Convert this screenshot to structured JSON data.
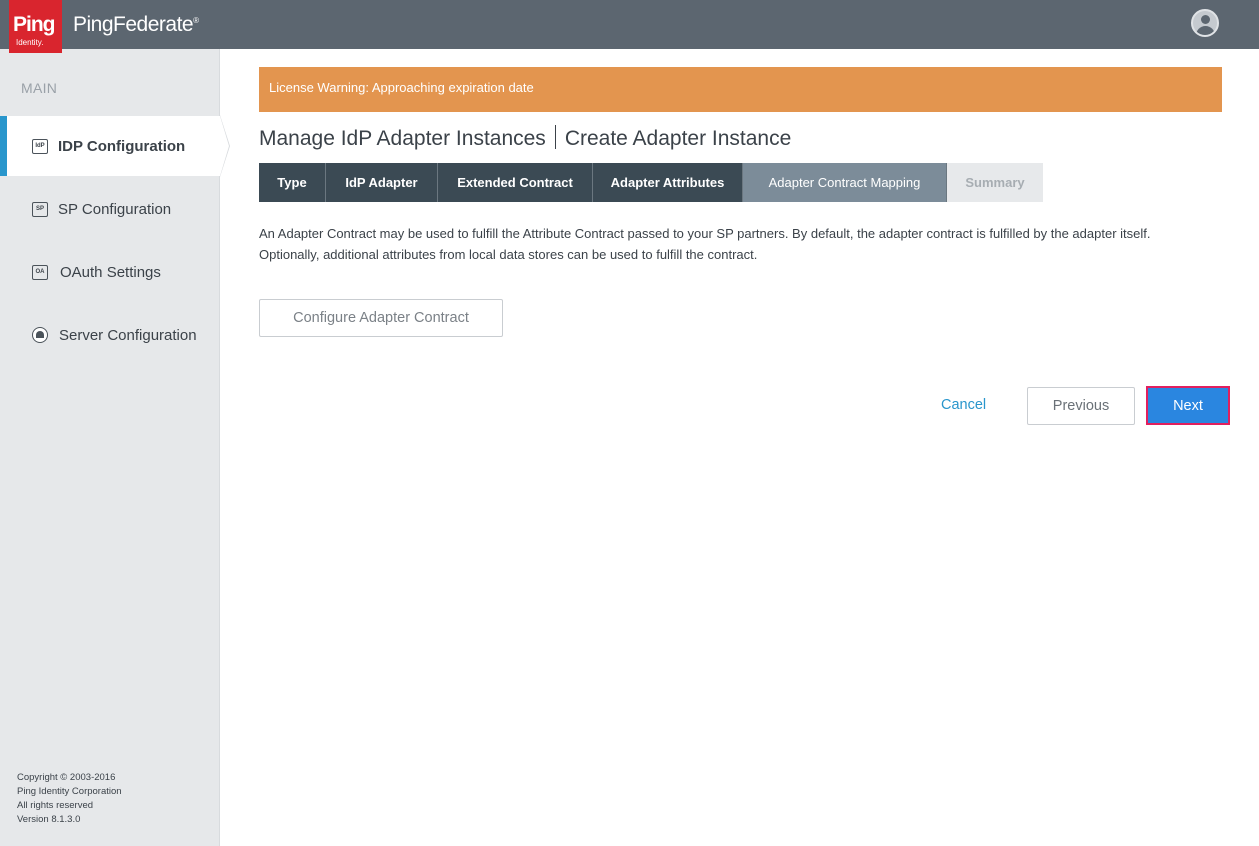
{
  "brand": {
    "logo_text": "Ping",
    "logo_subtext": "Identity.",
    "product_name": "PingFederate",
    "product_mark": "®"
  },
  "sidebar": {
    "heading": "MAIN",
    "items": [
      {
        "label": "IDP Configuration",
        "icon_text": "IdP",
        "icon": "idp-icon",
        "active": true
      },
      {
        "label": "SP Configuration",
        "icon_text": "SP",
        "icon": "sp-icon",
        "active": false
      },
      {
        "label": "OAuth Settings",
        "icon_text": "OA",
        "icon": "oauth-icon",
        "active": false
      },
      {
        "label": "Server Configuration",
        "icon": "server-icon",
        "active": false
      }
    ],
    "copyright": {
      "line1": "Copyright © 2003-2016",
      "line2": "Ping Identity Corporation",
      "line3": "All rights reserved",
      "line4": "Version 8.1.3.0"
    }
  },
  "warning": {
    "text": "License Warning: Approaching expiration date"
  },
  "page": {
    "title_main": "Manage IdP Adapter Instances",
    "title_sub": "Create Adapter Instance"
  },
  "steps": [
    {
      "label": "Type",
      "state": "done"
    },
    {
      "label": "IdP Adapter",
      "state": "done"
    },
    {
      "label": "Extended Contract",
      "state": "done"
    },
    {
      "label": "Adapter Attributes",
      "state": "done"
    },
    {
      "label": "Adapter Contract Mapping",
      "state": "current"
    },
    {
      "label": "Summary",
      "state": "future"
    }
  ],
  "content": {
    "description_line1": "An Adapter Contract may be used to fulfill the Attribute Contract passed to your SP partners. By default, the adapter contract is fulfilled by the adapter itself.",
    "description_line2": "Optionally, additional attributes from local data stores can be used to fulfill the contract.",
    "configure_button": "Configure Adapter Contract"
  },
  "actions": {
    "cancel": "Cancel",
    "previous": "Previous",
    "next": "Next"
  },
  "colors": {
    "topbar": "#5c6670",
    "brand_red": "#d9252e",
    "warning": "#e3954f",
    "active_accent": "#2996cc",
    "primary_button": "#2a86e0",
    "highlight_border": "#e21f5e"
  }
}
